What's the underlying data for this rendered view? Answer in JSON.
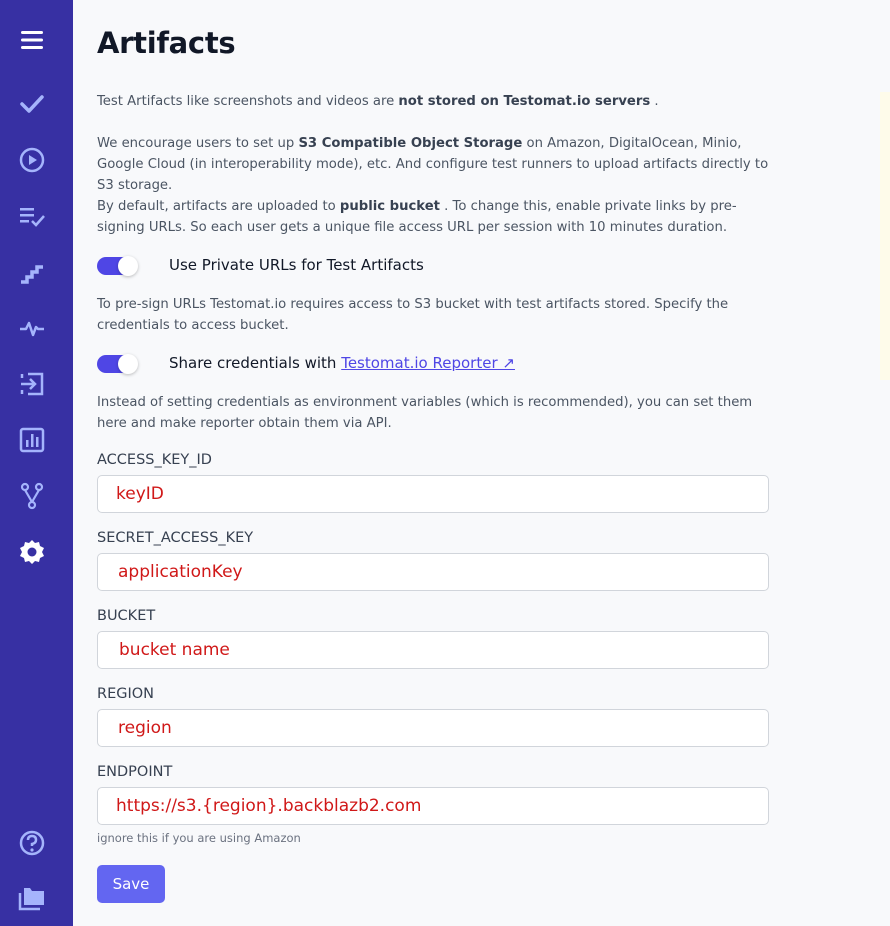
{
  "sidebar": {
    "icons": [
      "menu-icon",
      "check-icon",
      "play-icon",
      "list-check-icon",
      "steps-icon",
      "pulse-icon",
      "import-icon",
      "chart-icon",
      "branch-icon",
      "gear-icon",
      "help-icon",
      "folder-icon"
    ]
  },
  "page": {
    "title": "Artifacts",
    "intro": {
      "prefix": "Test Artifacts like screenshots and videos are ",
      "bold": "not stored on Testomat.io servers",
      "suffix": " ."
    },
    "encourage": {
      "prefix": "We encourage users to set up ",
      "bold": "S3 Compatible Object Storage",
      "suffix": " on Amazon, DigitalOcean, Minio, Google Cloud (in interoperability mode), etc. And configure test runners to upload artifacts directly to S3 storage."
    },
    "default": {
      "prefix": "By default, artifacts are uploaded to ",
      "bold": "public bucket",
      "suffix": " . To change this, enable private links by pre-signing URLs. So each user gets a unique file access URL per session with 10 minutes duration."
    },
    "private_toggle": {
      "label": "Use Private URLs for Test Artifacts",
      "on": true
    },
    "presign_text": "To pre-sign URLs Testomat.io requires access to S3 bucket with test artifacts stored. Specify the credentials to access bucket.",
    "share_toggle": {
      "label": "Share credentials with ",
      "link": "Testomat.io Reporter ↗",
      "on": true
    },
    "env_text": "Instead of setting credentials as environment variables (which is recommended), you can set them here and make reporter obtain them via API.",
    "fields": {
      "access_key": {
        "label": "ACCESS_KEY_ID",
        "value": "keyID"
      },
      "secret_key": {
        "label": "SECRET_ACCESS_KEY",
        "value": "applicationKey"
      },
      "bucket": {
        "label": "BUCKET",
        "value": "bucket name"
      },
      "region": {
        "label": "REGION",
        "value": "region"
      },
      "endpoint": {
        "label": "ENDPOINT",
        "value": "https://s3.{region}.backblazb2.com"
      }
    },
    "endpoint_hint": "ignore this if you are using Amazon",
    "save_label": "Save"
  },
  "colors": {
    "sidebar": "#3730a3",
    "icon": "#a5b4fc",
    "accent": "#4f46e5",
    "button": "#6366f1",
    "field_value": "#d01818"
  }
}
